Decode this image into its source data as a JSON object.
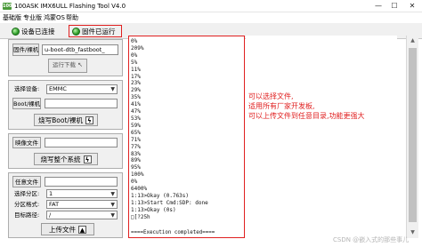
{
  "window": {
    "title": "100ASK IMX6ULL Flashing Tool V4.0",
    "icon_text": "100",
    "controls": [
      "—",
      "☐",
      "✕"
    ]
  },
  "menu": [
    "基础版",
    "专业版",
    "鸿蒙OS",
    "帮助"
  ],
  "toolbar": {
    "connection_label": "设备已连接",
    "firmware_label": "固件已运行"
  },
  "firmware_panel": {
    "firmware_button": "固件/裸机",
    "firmware_value": "u-boot-dtb_fastboot_",
    "run_button": "运行下载"
  },
  "device_panel": {
    "select_device_label": "选择设备:",
    "select_device_value": "EMMC",
    "boot_label": "Boot/裸机",
    "boot_value": "",
    "burn_boot_button": "烧写Boot/裸机"
  },
  "image_panel": {
    "image_label": "映像文件",
    "image_value": "",
    "burn_system_button": "烧写整个系统"
  },
  "any_panel": {
    "any_file_label": "任意文件",
    "any_file_value": "",
    "select_partition_label": "选择分区:",
    "select_partition_value": "1",
    "partition_format_label": "分区格式:",
    "partition_format_value": "FAT",
    "target_path_label": "目标路径:",
    "target_path_value": "/",
    "upload_button": "上传文件"
  },
  "log": {
    "lines": [
      "0%",
      "209%",
      "0%",
      "5%",
      "11%",
      "17%",
      "23%",
      "29%",
      "35%",
      "41%",
      "47%",
      "53%",
      "59%",
      "65%",
      "71%",
      "77%",
      "83%",
      "89%",
      "95%",
      "100%",
      "0%",
      "6400%",
      "1:13>Okay (0.763s)",
      "1:13>Start Cmd:SDP: done",
      "1:13>Okay (0s)",
      "□[?25h"
    ],
    "footer": "====Execution completed===="
  },
  "annotation": "可以选择文件,\n适用所有厂家开发板,\n可以上传文件到任意目录,功能更强大",
  "watermark": "CSDN @嵌入式的那些事儿"
}
